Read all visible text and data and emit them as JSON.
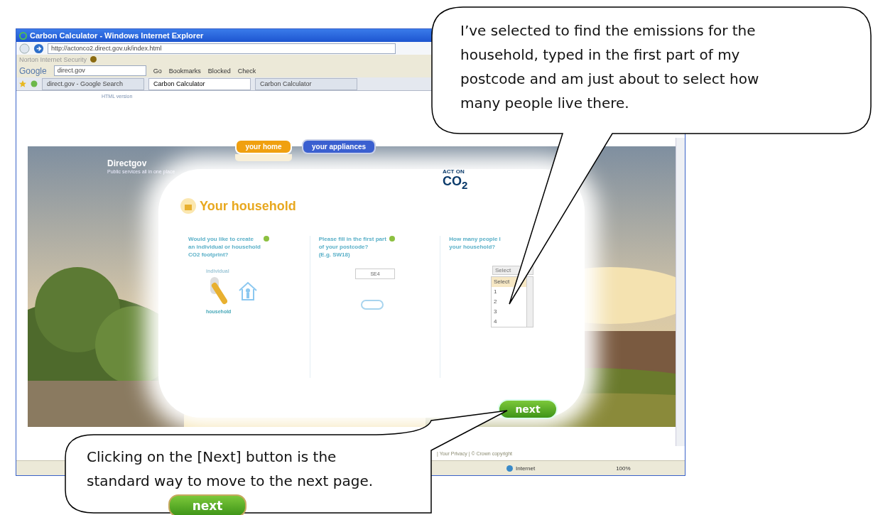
{
  "browser": {
    "title": "Carbon Calculator - Windows Internet Explorer",
    "address": "http://actonco2.direct.gov.uk/index.html",
    "security_toolbar": "Norton Internet Security",
    "google_label": "Google",
    "google_search": "direct.gov",
    "toolbar_items": [
      "Go",
      "Bookmarks",
      "Blocked",
      "Check"
    ],
    "tabs": [
      {
        "label": "direct.gov - Google Search",
        "selected": false
      },
      {
        "label": "Carbon Calculator",
        "selected": true
      },
      {
        "label": "Carbon Calculator",
        "selected": false
      }
    ],
    "footer": "| Your Privacy | © Crown copyright",
    "status": {
      "zone": "Internet",
      "zoom": "100%"
    }
  },
  "page": {
    "html_link": "HTML version",
    "brand": "Directgov",
    "tagline": "Public services all in one place",
    "nav": [
      {
        "label": "your home",
        "selected": true,
        "color": "#f0a010"
      },
      {
        "label": "your appliances",
        "selected": false,
        "color": "#3a5fd0"
      }
    ],
    "logo": {
      "small": "ACT ON",
      "big": "CO$_{2}$"
    },
    "panel_title": "Your household",
    "questions": [
      {
        "kind": "toggle",
        "lines": [
          "Would you like to create",
          "an individual or household",
          "CO2 footprint?"
        ],
        "options": [
          {
            "label": "individual",
            "selected": false
          },
          {
            "label": "household",
            "selected": true
          }
        ]
      },
      {
        "kind": "postcode",
        "lines": [
          "Please fill in the first part",
          "of your postcode?",
          "(E.g. SW18)"
        ],
        "value": "SE4"
      },
      {
        "kind": "select",
        "lines": [
          "How many people l",
          "your household?"
        ],
        "select_value": "Select",
        "options": [
          {
            "label": "Select",
            "selected": true
          },
          {
            "label": "1",
            "selected": false
          },
          {
            "label": "2",
            "selected": false
          },
          {
            "label": "3",
            "selected": false
          },
          {
            "label": "4",
            "selected": false
          }
        ]
      }
    ],
    "next_button": "next"
  },
  "callouts": [
    {
      "kind": "top",
      "text": "I’ve selected to find the emissions for the household, typed in the first part of my postcode and am just about to select how many people live there."
    },
    {
      "kind": "bottom",
      "text": "Clicking on the [Next] button is the standard way to move to the next page.",
      "button": "next"
    }
  ]
}
